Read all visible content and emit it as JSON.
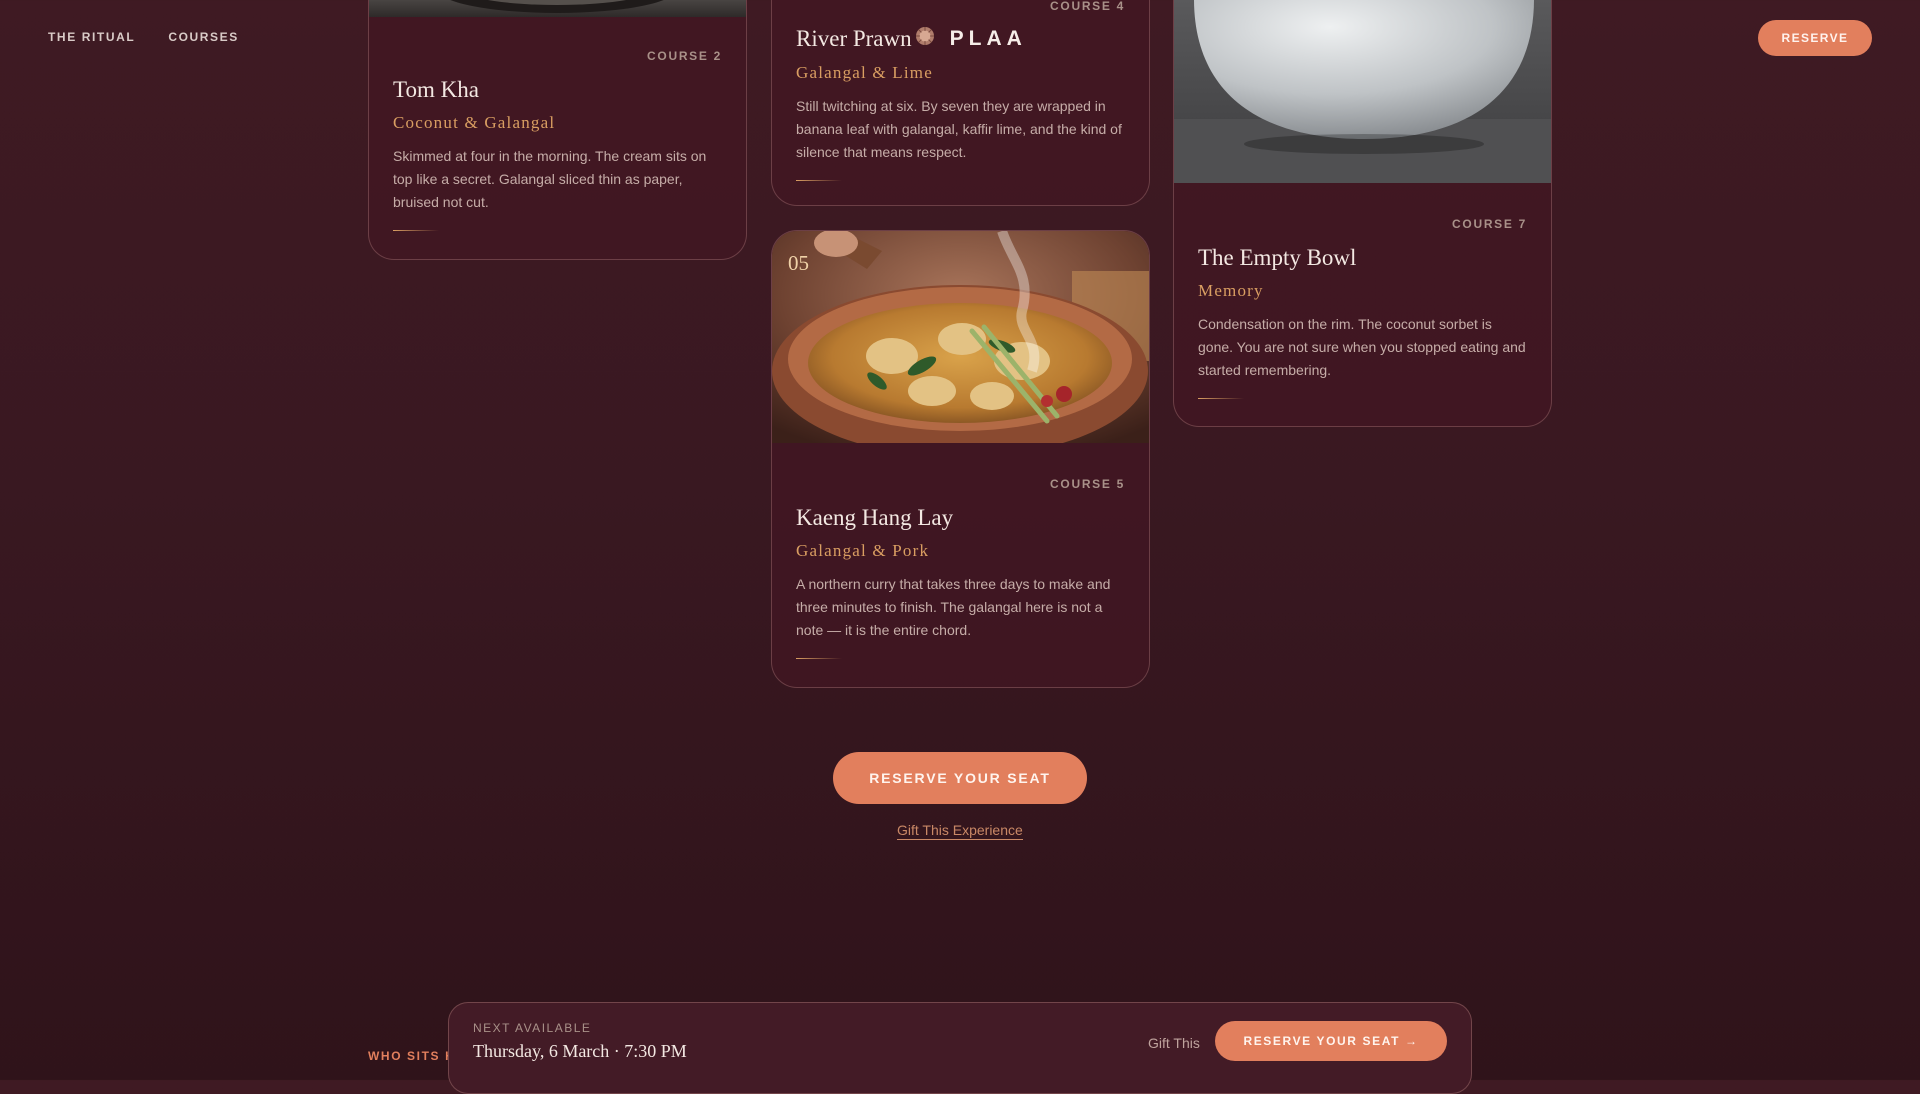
{
  "nav": {
    "links": [
      "THE RITUAL",
      "COURSES"
    ],
    "reserve_label": "RESERVE"
  },
  "cards": {
    "tomkha": {
      "course": "COURSE 2",
      "title": "Tom Kha",
      "pairing": "Coconut & Galangal",
      "desc": "Skimmed at four in the morning. The cream sits on top like a secret. Galangal sliced thin as paper, bruised not cut."
    },
    "prawn": {
      "course": "COURSE 4",
      "title": "River Prawn",
      "title_extra": "PLAA",
      "pairing": "Galangal & Lime",
      "desc": "Still twitching at six. By seven they are wrapped in banana leaf with galangal, kaffir lime, and the kind of silence that means respect."
    },
    "kaeng": {
      "number": "05",
      "course": "COURSE 5",
      "title": "Kaeng Hang Lay",
      "pairing": "Galangal & Pork",
      "desc": "A northern curry that takes three days to make and three minutes to finish. The galangal here is not a note — it is the entire chord."
    },
    "bowl": {
      "course": "COURSE 7",
      "title": "The Empty Bowl",
      "pairing": "Memory",
      "desc": "Condensation on the rim. The coconut sorbet is gone. You are not sure when you stopped eating and started remembering."
    }
  },
  "cta": {
    "reserve_label": "RESERVE YOUR SEAT",
    "gift_label": "Gift This Experience"
  },
  "who_label": "WHO SITS H",
  "bar": {
    "label": "NEXT AVAILABLE",
    "date": "Thursday, 6 March · 7:30 PM",
    "gift_label": "Gift This",
    "reserve_label": "RESERVE YOUR SEAT →"
  },
  "colors": {
    "accent": "#e27f5d",
    "pairing": "#d99e62",
    "background": "#3a1820"
  }
}
